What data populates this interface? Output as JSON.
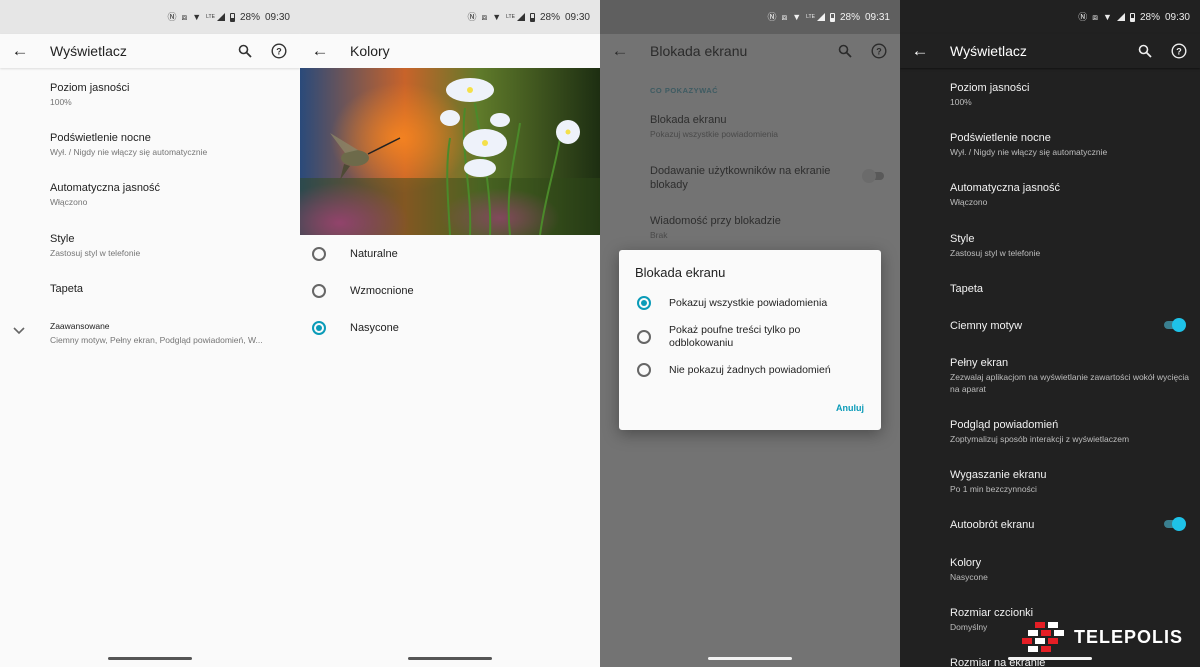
{
  "status": {
    "panel1": {
      "battery": "28%",
      "time": "09:30",
      "net": "LTE"
    },
    "panel2": {
      "battery": "28%",
      "time": "09:30",
      "net": "LTE"
    },
    "panel3": {
      "battery": "28%",
      "time": "09:31",
      "net": "LTE"
    },
    "panel4": {
      "battery": "28%",
      "time": "09:30"
    }
  },
  "display_light": {
    "title": "Wyświetlacz",
    "items": [
      {
        "title": "Poziom jasności",
        "subtitle": "100%"
      },
      {
        "title": "Podświetlenie nocne",
        "subtitle": "Wył. / Nigdy nie włączy się automatycznie"
      },
      {
        "title": "Automatyczna jasność",
        "subtitle": "Włączono"
      },
      {
        "title": "Style",
        "subtitle": "Zastosuj styl w telefonie"
      },
      {
        "title": "Tapeta"
      },
      {
        "title": "Zaawansowane",
        "subtitle": "Ciemny motyw, Pełny ekran, Podgląd powiadomień, W..."
      }
    ]
  },
  "colors": {
    "title": "Kolory",
    "options": [
      {
        "label": "Naturalne",
        "selected": false
      },
      {
        "label": "Wzmocnione",
        "selected": false
      },
      {
        "label": "Nasycone",
        "selected": true
      }
    ]
  },
  "lockscreen": {
    "title": "Blokada ekranu",
    "section": "CO POKAZYWAĆ",
    "items": [
      {
        "title": "Blokada ekranu",
        "subtitle": "Pokazuj wszystkie powiadomienia"
      },
      {
        "title": "Dodawanie użytkowników na ekranie blokady"
      },
      {
        "title": "Wiadomość przy blokadzie",
        "subtitle": "Brak"
      }
    ],
    "dialog": {
      "title": "Blokada ekranu",
      "options": [
        {
          "label": "Pokazuj wszystkie powiadomienia",
          "selected": true
        },
        {
          "label": "Pokaż poufne treści tylko po odblokowaniu",
          "selected": false
        },
        {
          "label": "Nie pokazuj żadnych powiadomień",
          "selected": false
        }
      ],
      "cancel": "Anuluj"
    }
  },
  "display_dark": {
    "title": "Wyświetlacz",
    "items": [
      {
        "title": "Poziom jasności",
        "subtitle": "100%"
      },
      {
        "title": "Podświetlenie nocne",
        "subtitle": "Wył. / Nigdy nie włączy się automatycznie"
      },
      {
        "title": "Automatyczna jasność",
        "subtitle": "Włączono"
      },
      {
        "title": "Style",
        "subtitle": "Zastosuj styl w telefonie"
      },
      {
        "title": "Tapeta"
      },
      {
        "title": "Ciemny motyw",
        "toggle": true
      },
      {
        "title": "Pełny ekran",
        "subtitle": "Zezwalaj aplikacjom na wyświetlanie zawartości wokół wycięcia na aparat"
      },
      {
        "title": "Podgląd powiadomień",
        "subtitle": "Zoptymalizuj sposób interakcji z wyświetlaczem"
      },
      {
        "title": "Wygaszanie ekranu",
        "subtitle": "Po 1 min bezczynności"
      },
      {
        "title": "Autoobrót ekranu",
        "toggle": true
      },
      {
        "title": "Kolory",
        "subtitle": "Nasycone"
      },
      {
        "title": "Rozmiar czcionki",
        "subtitle": "Domyślny"
      },
      {
        "title": "Rozmiar na ekranie"
      }
    ]
  },
  "watermark": {
    "text": "TELEPOLIS"
  },
  "colors_theme": {
    "accent": "#0a9bb8",
    "toggle_on": "#1ec2e8",
    "dark_bg": "#212121",
    "light_bg": "#fafafa"
  }
}
